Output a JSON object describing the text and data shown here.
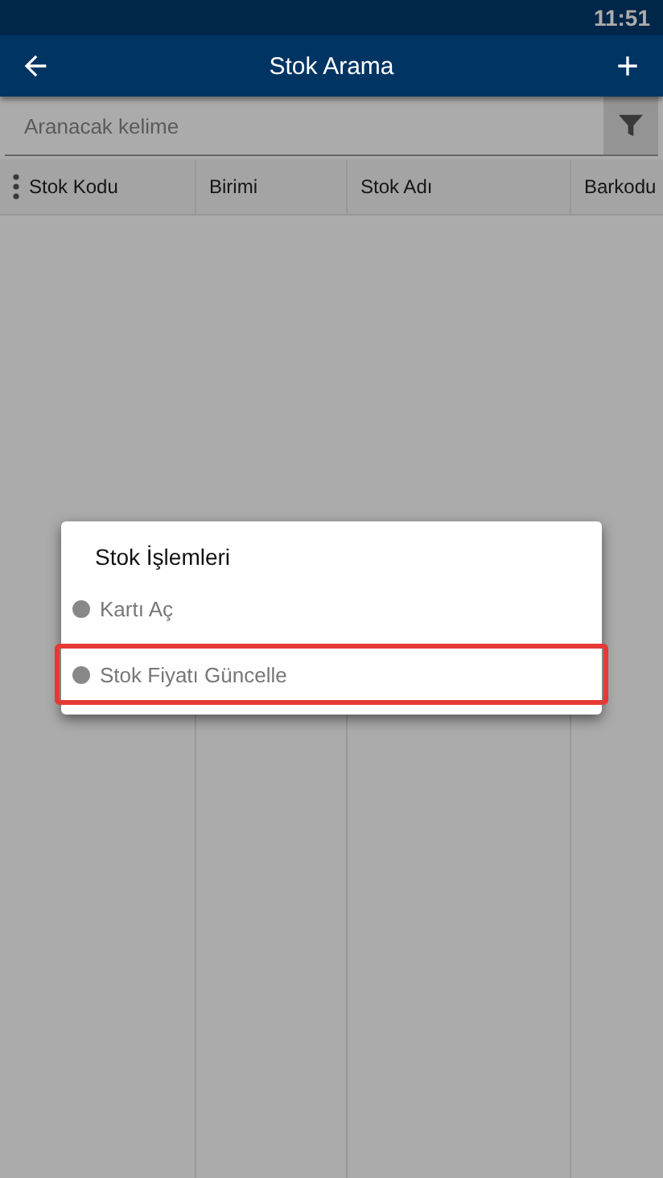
{
  "status_bar": {
    "time": "11:51"
  },
  "app_bar": {
    "title": "Stok Arama"
  },
  "search": {
    "placeholder": "Aranacak kelime"
  },
  "table": {
    "columns": [
      "Stok Kodu",
      "Birimi",
      "Stok Adı",
      "Barkodu"
    ]
  },
  "dialog": {
    "title": "Stok İşlemleri",
    "options": [
      {
        "label": "Kartı Aç",
        "selected": false
      },
      {
        "label": "Stok Fiyatı Güncelle",
        "selected": true
      }
    ]
  }
}
